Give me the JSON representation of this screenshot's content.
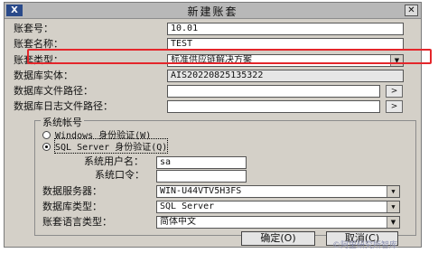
{
  "window": {
    "title": "新建账套",
    "icon_text": "X",
    "close_glyph": "✕"
  },
  "fields": {
    "set_no": {
      "label": "账套号：",
      "value": "10.01"
    },
    "set_name": {
      "label": "账套名称：",
      "value": "TEST"
    },
    "set_type": {
      "label": "账套类型：",
      "value": "标准供应链解决方案"
    },
    "db_instance": {
      "label": "数据库实体：",
      "value": "AIS20220825135322"
    },
    "db_file_path": {
      "label": "数据库文件路径：",
      "value": ""
    },
    "db_log_path": {
      "label": "数据库日志文件路径：",
      "value": ""
    }
  },
  "browse_glyph": ">",
  "dropdown_glyph": "▼",
  "auth": {
    "group_title": "系统帐号",
    "windows_label": "Windows 身份验证(W)",
    "sql_label": "SQL Server 身份验证(Q)",
    "selected": "sql",
    "username_label": "系统用户名：",
    "username_value": "sa",
    "password_label": "系统口令：",
    "password_value": ""
  },
  "server": {
    "server_label": "数据服务器：",
    "server_value": "WIN-U44VTV5H3FS",
    "dbtype_label": "数据库类型：",
    "dbtype_value": "SQL Server",
    "lang_label": "账套语言类型：",
    "lang_value": "简体中文"
  },
  "buttons": {
    "ok": "确定(O)",
    "cancel": "取消(C)"
  },
  "watermark": "©阿里研究所智库",
  "colors": {
    "highlight": "#e4262b",
    "title_bar": "#b8b8b8",
    "dialog_bg": "#d4d0c8"
  }
}
